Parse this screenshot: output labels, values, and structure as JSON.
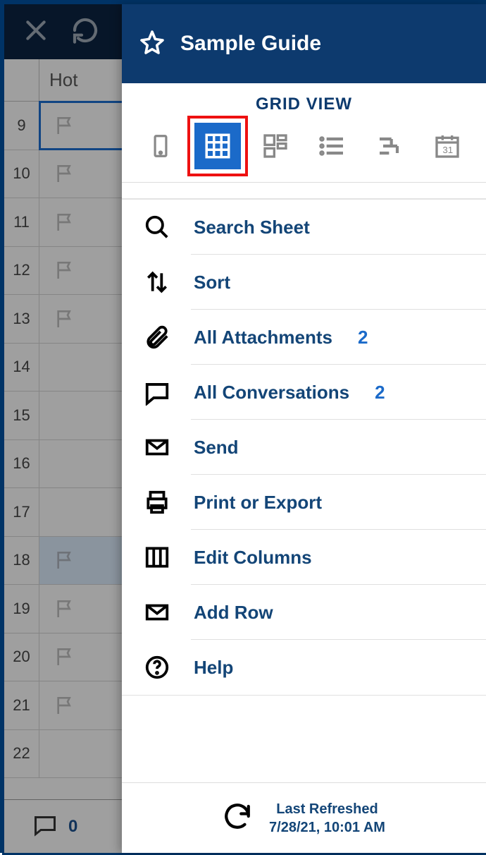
{
  "background": {
    "column_header": "Hot",
    "rows": [
      9,
      10,
      11,
      12,
      13,
      14,
      15,
      16,
      17,
      18,
      19,
      20,
      21,
      22
    ],
    "selected_row": 9,
    "highlighted_row": 18,
    "flag_rows": [
      9,
      10,
      11,
      12,
      13,
      18,
      19,
      20,
      21
    ],
    "conversation_count": 0
  },
  "panel": {
    "title": "Sample Guide",
    "section_label": "GRID VIEW",
    "views": [
      {
        "name": "mobile-view",
        "active": false
      },
      {
        "name": "grid-view",
        "active": true,
        "highlighted": true
      },
      {
        "name": "card-view",
        "active": false
      },
      {
        "name": "list-view",
        "active": false
      },
      {
        "name": "gantt-view",
        "active": false
      },
      {
        "name": "calendar-view",
        "active": false
      }
    ],
    "menu": [
      {
        "icon": "search-icon",
        "label": "Search Sheet"
      },
      {
        "icon": "sort-icon",
        "label": "Sort"
      },
      {
        "icon": "attachment-icon",
        "label": "All Attachments",
        "badge": 2
      },
      {
        "icon": "comment-icon",
        "label": "All Conversations",
        "badge": 2
      },
      {
        "icon": "mail-icon",
        "label": "Send"
      },
      {
        "icon": "print-icon",
        "label": "Print or Export"
      },
      {
        "icon": "columns-icon",
        "label": "Edit Columns"
      },
      {
        "icon": "mail-icon",
        "label": "Add Row"
      },
      {
        "icon": "help-icon",
        "label": "Help"
      }
    ],
    "footer": {
      "line1": "Last Refreshed",
      "line2": "7/28/21, 10:01 AM"
    }
  }
}
